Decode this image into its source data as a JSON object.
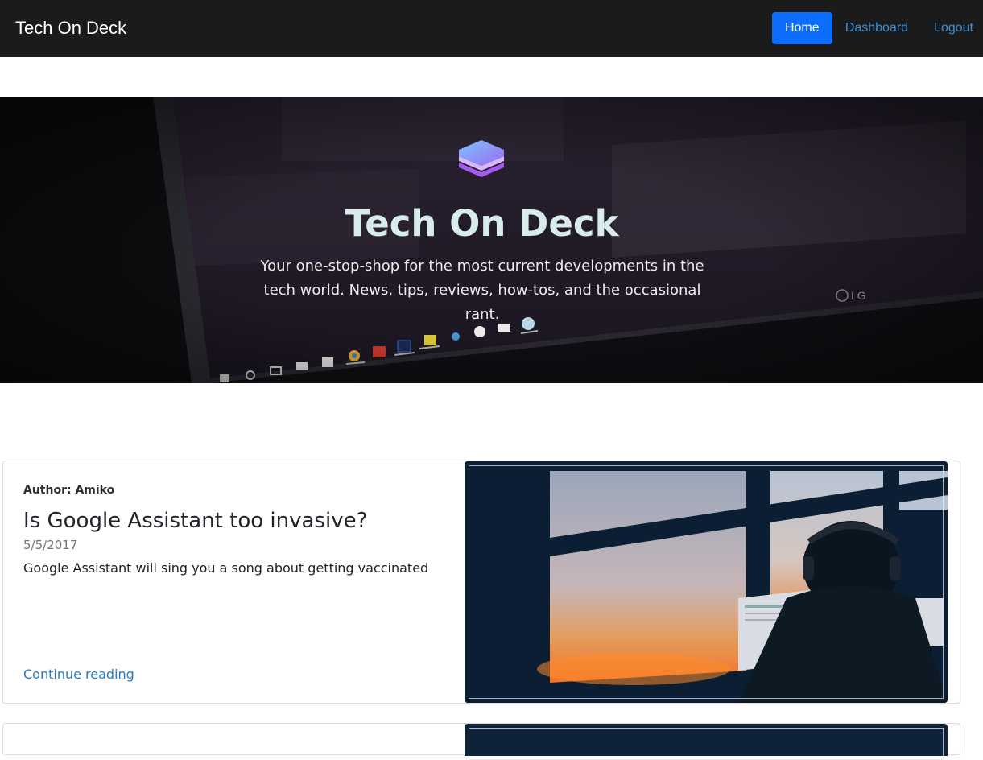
{
  "navbar": {
    "brand": "Tech On Deck",
    "links": [
      {
        "label": "Home",
        "active": true
      },
      {
        "label": "Dashboard",
        "active": false
      },
      {
        "label": "Logout",
        "active": false
      }
    ]
  },
  "hero": {
    "logo_icon": "layers-stack-icon",
    "title": "Tech On Deck",
    "subtitle": "Your one-stop-shop for the most current developments in the tech world. News, tips, reviews, how-tos, and the occasional rant.",
    "background_image": "monitor-taskbar-photo"
  },
  "posts": [
    {
      "author_label": "Author: Amiko",
      "title": "Is Google Assistant too invasive?",
      "date": "5/5/2017",
      "excerpt": "Google Assistant will sing you a song about getting vaccinated",
      "link_label": "Continue reading",
      "image": "person-at-window-sunset-photo"
    }
  ],
  "colors": {
    "navbar_bg": "#1b1b1b",
    "active_link_bg": "#0d6efd",
    "link": "#3b8fd9"
  }
}
